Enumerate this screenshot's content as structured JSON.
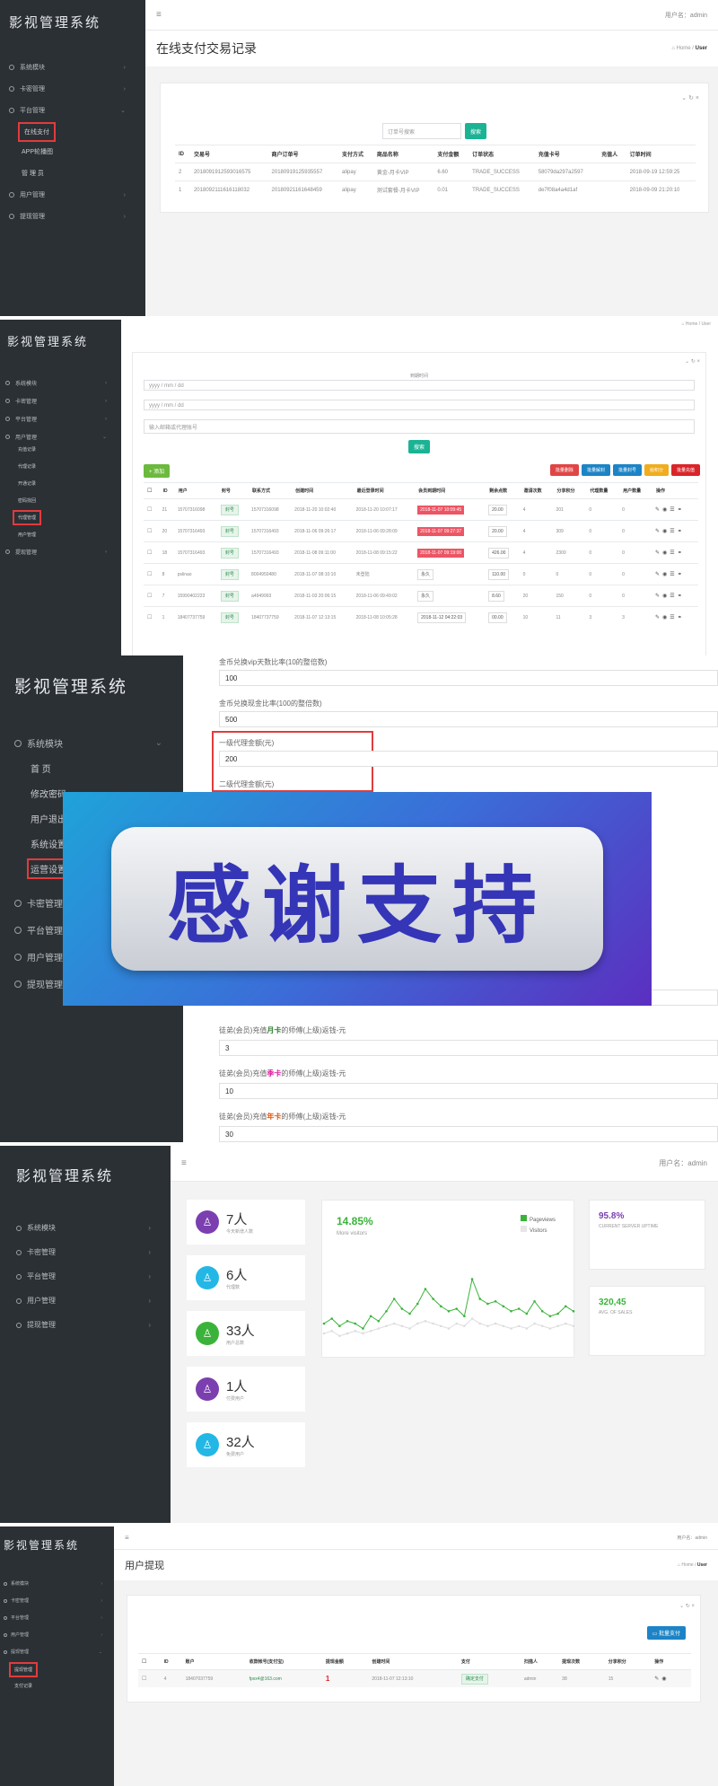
{
  "brand": "影视管理系统",
  "panel1": {
    "menu": [
      {
        "label": "系统模块"
      },
      {
        "label": "卡密管理"
      },
      {
        "label": "平台管理"
      }
    ],
    "sub": [
      "在线支付",
      "APP轮播图",
      "管 理 员"
    ],
    "menu_after": [
      {
        "label": "用户管理"
      },
      {
        "label": "提现管理"
      }
    ],
    "topbar_right": "用户名：admin",
    "page_title": "在线支付交易记录",
    "breadcrumb": [
      "Home",
      "User"
    ],
    "search_placeholder": "订单号搜索",
    "search_button": "搜索",
    "columns": [
      "ID",
      "交易号",
      "商户订单号",
      "支付方式",
      "商品名称",
      "支付金额",
      "订单状态",
      "充值卡号",
      "充值人",
      "订单时间"
    ],
    "rows": [
      [
        "2",
        "2018091912593016575",
        "20180919125935557",
        "alipay",
        "黄金-月卡VIP",
        "6.60",
        "TRADE_SUCCESS",
        "58079da297a2597",
        "",
        "2018-09-19 12:59:25"
      ],
      [
        "1",
        "2018092111616118032",
        "20180921161648459",
        "alipay",
        "测试套餐-月卡VIP",
        "0.01",
        "TRADE_SUCCESS",
        "de7f08a4a4d1af",
        "",
        "2018-09-09 21:20:10"
      ]
    ]
  },
  "panel2": {
    "menu": [
      "系统模块",
      "卡密管理",
      "平台管理",
      "用户管理"
    ],
    "sub": [
      "充值记录",
      "代理记录",
      "开通记录",
      "密码找回",
      "代理管理",
      "用户管理"
    ],
    "menu_after": [
      "提现管理"
    ],
    "breadcrumb": [
      "Home",
      "User"
    ],
    "date_label": "到期时间",
    "date1": "yyyy / mm / dd",
    "date2": "yyyy / mm / dd",
    "search_placeholder": "输入邮箱或代理账号",
    "search_button": "搜索",
    "add_button": "添加",
    "action_buttons": [
      "批量删除",
      "批量解封",
      "批量封号",
      "给积分",
      "批量充值"
    ],
    "columns": [
      "ID",
      "用户",
      "封号",
      "联系方式",
      "创建时间",
      "最近登录时间",
      "会员到期时间",
      "剩余点数",
      "邀请次数",
      "分享积分",
      "代理数量",
      "用户数量",
      "操作"
    ],
    "rows": [
      [
        "21",
        "15707316098",
        "封号",
        "15707316098",
        "2018-11-20 10:02:40",
        "2018-11-20 10:07:17",
        "2018-11-07 10:09:45",
        "20.00",
        "4",
        "201",
        "0",
        "0"
      ],
      [
        "20",
        "15707316493",
        "封号",
        "15707316493",
        "2018-11-06 09:26:17",
        "2018-11-06 09:28:09",
        "2018-11-07 09:27:37",
        "20.00",
        "4",
        "309",
        "0",
        "0"
      ],
      [
        "18",
        "15707316493",
        "封号",
        "15707316493",
        "2018-11-08 09:11:00",
        "2018-11-08 09:15:22",
        "2018-11-07 09:19:00",
        "426.00",
        "4",
        "2300",
        "0",
        "0"
      ],
      [
        "8",
        "pslinao",
        "封号",
        "8004950480",
        "2018-11-07 08:10:10",
        "未登陆",
        "永久",
        "110.00",
        "0",
        "0",
        "0",
        "0"
      ],
      [
        "7",
        "15990402223",
        "封号",
        "a4949993",
        "2018-11-03 20:06:15",
        "2018-11-06 09:49:02",
        "永久",
        "8.60",
        "20",
        "150",
        "0",
        "0"
      ],
      [
        "1",
        "18407737759",
        "封号",
        "18407737759",
        "2018-11-07 12:13:15",
        "2018-11-08 10:05:28",
        "2018-11-12 04:22:03",
        "00.00",
        "10",
        "11",
        "3",
        "3"
      ]
    ]
  },
  "panel3": {
    "menu": [
      "系统模块",
      "卡密管理",
      "平台管理",
      "用户管理",
      "提现管理"
    ],
    "sub": [
      "首    页",
      "修改密码",
      "用户退出",
      "系统设置",
      "运营设置"
    ],
    "fields": [
      {
        "label": "金币兑换vip天数比率(10的整倍数)",
        "value": "100"
      },
      {
        "label": "金币兑换现金比率(100的整倍数)",
        "value": "500"
      },
      {
        "label": "一级代理金额(元)",
        "value": "200"
      },
      {
        "label": "二级代理金额(元)",
        "value": ""
      }
    ],
    "lower_fields": [
      {
        "label_pre": "徒弟(会员)充值",
        "label_hl": "月卡",
        "label_post": "的师傅(上级)返钱-元",
        "value": "3",
        "hl_color": "#2e7d32"
      },
      {
        "label_pre": "徒弟(会员)充值",
        "label_hl": "季卡",
        "label_post": "的师傅(上级)返钱-元",
        "value": "10",
        "hl_color": "#d81b9c"
      },
      {
        "label_pre": "徒弟(会员)充值",
        "label_hl": "年卡",
        "label_post": "的师傅(上级)返钱-元",
        "value": "30",
        "hl_color": "#e65100"
      }
    ],
    "partial_value": "50",
    "banner_text": "感谢支持"
  },
  "panel4": {
    "menu": [
      "系统模块",
      "卡密管理",
      "平台管理",
      "用户管理",
      "提现管理"
    ],
    "topbar_right": "用户名：admin",
    "stats": [
      {
        "num": "7人",
        "sub": "今天新增人数",
        "color": "#7b3fb0",
        "icon": "user-icon"
      },
      {
        "num": "6人",
        "sub": "代理数",
        "color": "#23b7e5",
        "icon": "user-icon"
      },
      {
        "num": "33人",
        "sub": "用户总数",
        "color": "#3bb33b",
        "icon": "user-icon"
      },
      {
        "num": "1人",
        "sub": "付费用户",
        "color": "#7b3fb0",
        "icon": "user-icon"
      },
      {
        "num": "32人",
        "sub": "免费用户",
        "color": "#23b7e5",
        "icon": "user-icon"
      }
    ],
    "chart_pct": "14.85%",
    "chart_sub": "More visitors",
    "legend": [
      "Pageviews",
      "Visitors"
    ],
    "kpi1_value": "95.8%",
    "kpi1_label": "CURRENT SERVER UPTIME",
    "kpi2_value": "320,45",
    "kpi2_label": "AVG. OF SALES"
  },
  "panel5": {
    "menu": [
      "系统模块",
      "卡密管理",
      "平台管理",
      "用户管理",
      "提现管理"
    ],
    "sub": [
      "提现管理",
      "支付记录"
    ],
    "topbar_right": "用户名：admin",
    "page_title": "用户提现",
    "breadcrumb": [
      "Home",
      "User"
    ],
    "batch_button": "批量支付",
    "columns": [
      "ID",
      "账户",
      "收款帐号(支付宝)",
      "提现金额",
      "创建时间",
      "支付",
      "扫描人",
      "提现次数",
      "分享积分",
      "操作"
    ],
    "rows": [
      [
        "4",
        "18407037759",
        "fpxx4@163.com",
        "1",
        "2018-11-07 12:13:10",
        "确定支付",
        "admin",
        "38",
        "15"
      ]
    ]
  },
  "chart_data": {
    "type": "line",
    "series": [
      {
        "name": "Pageviews",
        "values": [
          12,
          14,
          11,
          13,
          12,
          10,
          15,
          13,
          17,
          22,
          18,
          16,
          20,
          26,
          22,
          19,
          17,
          18,
          15,
          30,
          22,
          20,
          21,
          19,
          17,
          18,
          16,
          21,
          17,
          15,
          16,
          19,
          17
        ]
      },
      {
        "name": "Visitors",
        "values": [
          8,
          9,
          7,
          8,
          9,
          8,
          9,
          10,
          11,
          12,
          11,
          10,
          12,
          13,
          12,
          11,
          10,
          12,
          11,
          14,
          12,
          11,
          12,
          11,
          10,
          11,
          10,
          12,
          11,
          10,
          11,
          12,
          11
        ]
      }
    ],
    "ylim": [
      0,
      40
    ]
  }
}
